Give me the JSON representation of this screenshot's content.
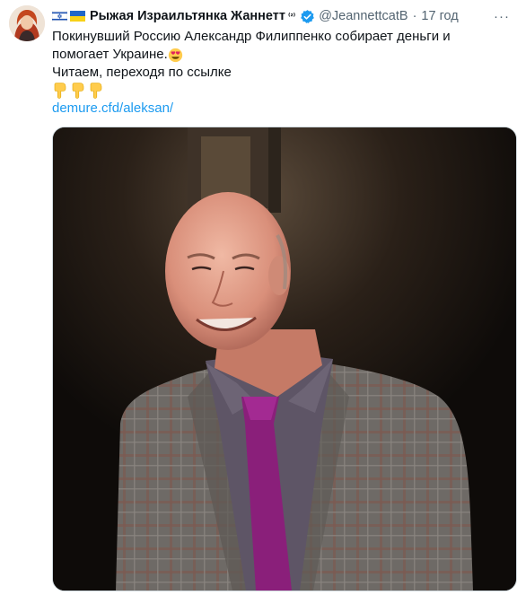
{
  "tweet": {
    "name": "Рыжая Израильтянка Жаннетт",
    "name_sup": "⁽²⁾",
    "handle": "@JeannettcatB",
    "time": "17 год",
    "more": "···",
    "text_line1": "Покинувший Россию Александр Филиппенко собирает деньги и",
    "text_line2": "помогает Украине.",
    "text_line3": "Читаем, переходя по ссылке",
    "link": "demure.cfd/aleksan/"
  },
  "colors": {
    "link": "#1d9bf0",
    "verified": "#1d9bf0",
    "muted": "#536471"
  },
  "icons": [
    "israel-flag-icon",
    "ukraine-flag-icon",
    "verified-badge-icon",
    "heart-eyes-emoji",
    "pointing-down-emoji"
  ]
}
